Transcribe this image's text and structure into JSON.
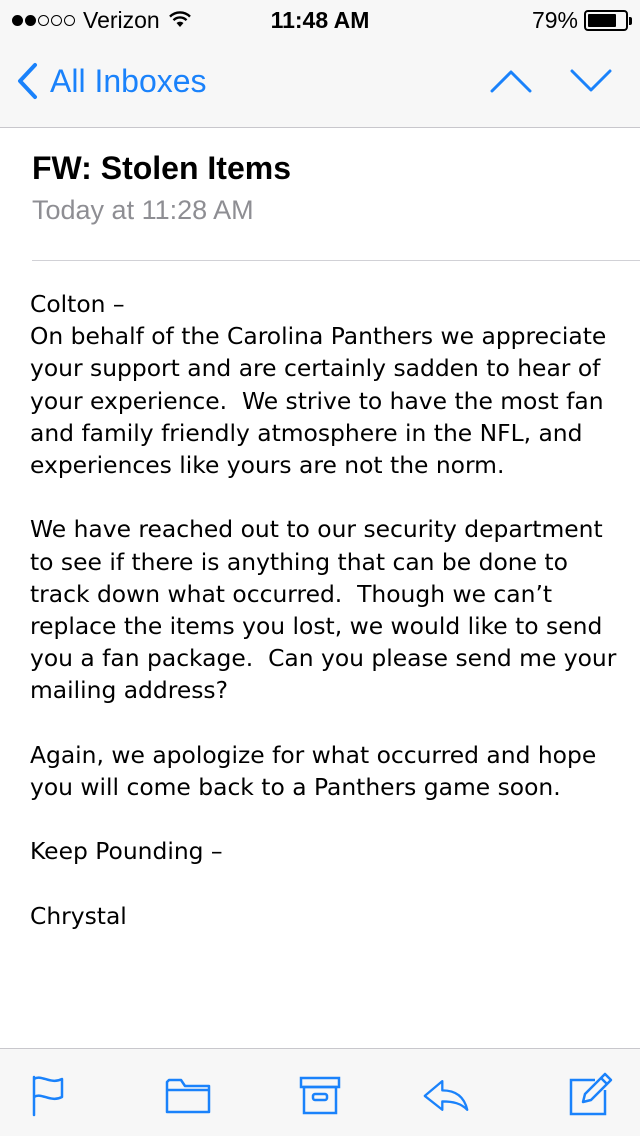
{
  "status_bar": {
    "carrier": "Verizon",
    "time": "11:48 AM",
    "battery": "79%",
    "battery_level": 0.79,
    "signal_bars_filled": 2,
    "signal_bars_total": 5
  },
  "nav": {
    "back_label": "All Inboxes",
    "accent_color": "#1a82fb"
  },
  "message": {
    "subject": "FW: Stolen Items",
    "date": "Today at 11:28 AM",
    "body": "Colton –\nOn behalf of the Carolina Panthers we appreciate your support and are certainly sadden to hear of your experience.  We strive to have the most fan and family friendly atmosphere in the NFL, and experiences like yours are not the norm.\n\nWe have reached out to our security department to see if there is anything that can be done to track down what occurred.  Though we can’t replace the items you lost, we would like to send you a fan package.  Can you please send me your mailing address?\n\nAgain, we apologize for what occurred and hope you will come back to a Panthers game soon.\n\nKeep Pounding –\n\nChrystal"
  },
  "toolbar": {
    "icons": [
      "flag-icon",
      "folder-icon",
      "archive-icon",
      "reply-icon",
      "compose-icon"
    ]
  }
}
